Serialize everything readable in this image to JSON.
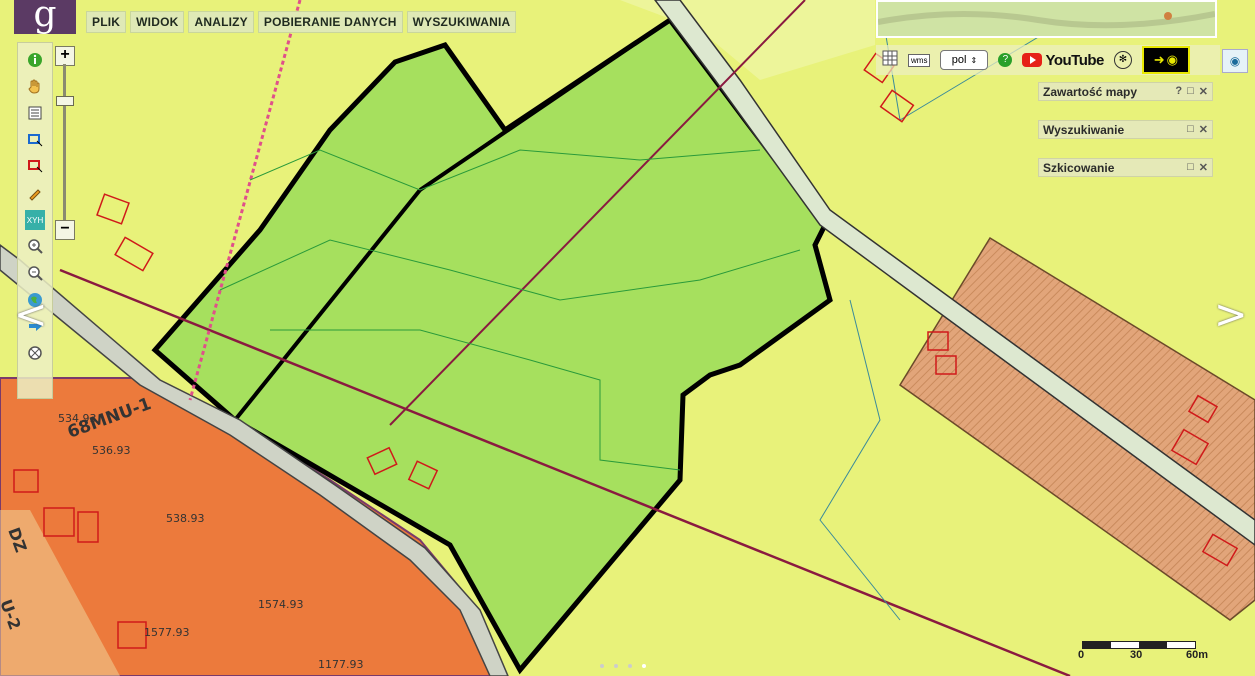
{
  "app": {
    "logo_letter": "g"
  },
  "menu": [
    {
      "label": "PLIK"
    },
    {
      "label": "WIDOK"
    },
    {
      "label": "ANALIZY"
    },
    {
      "label": "POBIERANIE DANYCH"
    },
    {
      "label": "WYSZUKIWANIA"
    }
  ],
  "toolbar": {
    "tools": [
      {
        "icon": "info-icon"
      },
      {
        "icon": "hand-pan-icon"
      },
      {
        "icon": "legend-icon"
      },
      {
        "icon": "select-blue-icon"
      },
      {
        "icon": "select-red-icon"
      },
      {
        "icon": "pencil-icon"
      },
      {
        "icon": "xyh-icon",
        "label": "XYH"
      },
      {
        "icon": "zoom-in-icon"
      },
      {
        "icon": "zoom-out-icon"
      },
      {
        "icon": "globe-icon"
      },
      {
        "icon": "arrow-right-icon"
      },
      {
        "icon": "crosshair-icon"
      }
    ],
    "zoom_plus": "+",
    "zoom_minus": "−"
  },
  "top_right": {
    "wms_label": "wms",
    "language": "pol",
    "youtube_label": "YouTube"
  },
  "panels": [
    {
      "title": "Zawartość mapy",
      "help": "?"
    },
    {
      "title": "Wyszukiwanie"
    },
    {
      "title": "Szkicowanie"
    }
  ],
  "map_labels": {
    "zone_1": "68MNU-1",
    "zone_2": "U-2",
    "zone_3": "DZ",
    "elev_1": "534.93",
    "elev_2": "536.93",
    "elev_3": "538.93",
    "elev_4": "1574.93",
    "elev_5": "1577.93",
    "elev_6": "1177.93"
  },
  "scalebar": {
    "labels": [
      "0",
      "30",
      "60m"
    ]
  },
  "colors": {
    "background_zone": "#e8f27a",
    "parcel_green": "#a6e05e",
    "residential_orange": "#ec7a3c",
    "hatched_zone": "#e2a57a",
    "road": "#cfe0c0"
  }
}
